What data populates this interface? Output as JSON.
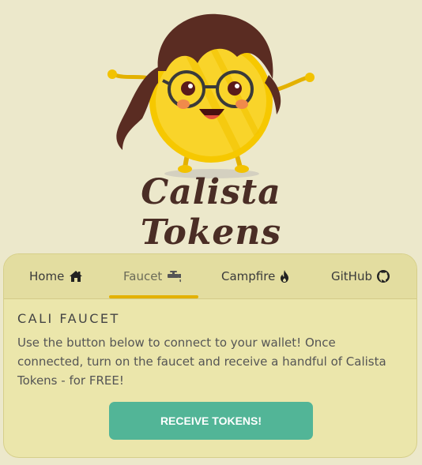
{
  "brand": {
    "logo_text": "Calista Tokens"
  },
  "tabs": [
    {
      "label": "Home",
      "icon": "home-icon"
    },
    {
      "label": "Faucet",
      "icon": "faucet-icon"
    },
    {
      "label": "Campfire",
      "icon": "fire-icon"
    },
    {
      "label": "GitHub",
      "icon": "github-icon"
    }
  ],
  "active_tab": "Faucet",
  "faucet": {
    "title": "CALI FAUCET",
    "description": "Use the button below to connect to your wallet! Once connected, turn on the faucet and receive a handful of Calista Tokens - for FREE!",
    "button_label": "RECEIVE TOKENS!"
  },
  "colors": {
    "background": "#ece8cb",
    "card": "#ebe6ab",
    "accent_underline": "#e3b100",
    "button": "#52b597",
    "brand_text": "#4a2d25"
  }
}
